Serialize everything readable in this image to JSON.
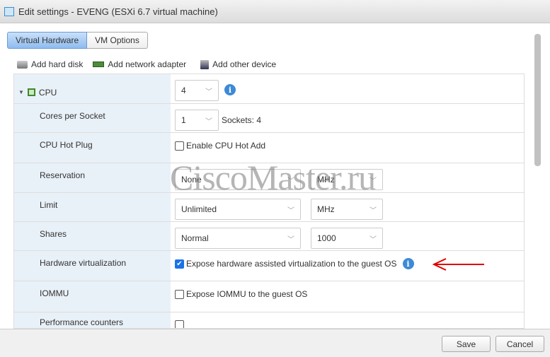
{
  "title": "Edit settings - EVENG (ESXi 6.7 virtual machine)",
  "tabs": [
    {
      "label": "Virtual Hardware",
      "active": true
    },
    {
      "label": "VM Options",
      "active": false
    }
  ],
  "toolbar": {
    "add_hard_disk": "Add hard disk",
    "add_network_adapter": "Add network adapter",
    "add_other_device": "Add other device"
  },
  "cpu": {
    "label": "CPU",
    "value": "4",
    "cores_per_socket": {
      "label": "Cores per Socket",
      "value": "1",
      "sockets": "Sockets: 4"
    },
    "hot_plug": {
      "label": "CPU Hot Plug",
      "checkbox": "Enable CPU Hot Add",
      "checked": false
    },
    "reservation": {
      "label": "Reservation",
      "value": "None",
      "unit": "MHz"
    },
    "limit": {
      "label": "Limit",
      "value": "Unlimited",
      "unit": "MHz"
    },
    "shares": {
      "label": "Shares",
      "value": "Normal",
      "amount": "1000"
    },
    "hw_virt": {
      "label": "Hardware virtualization",
      "checkbox": "Expose hardware assisted virtualization to the guest OS",
      "checked": true
    },
    "iommu": {
      "label": "IOMMU",
      "checkbox": "Expose IOMMU to the guest OS",
      "checked": false
    },
    "perf": {
      "label": "Performance counters"
    }
  },
  "footer": {
    "save": "Save",
    "cancel": "Cancel"
  },
  "watermark": "CiscoMaster.ru",
  "colors": {
    "annotation_arrow": "#e00000",
    "accent": "#3d8ad6"
  }
}
